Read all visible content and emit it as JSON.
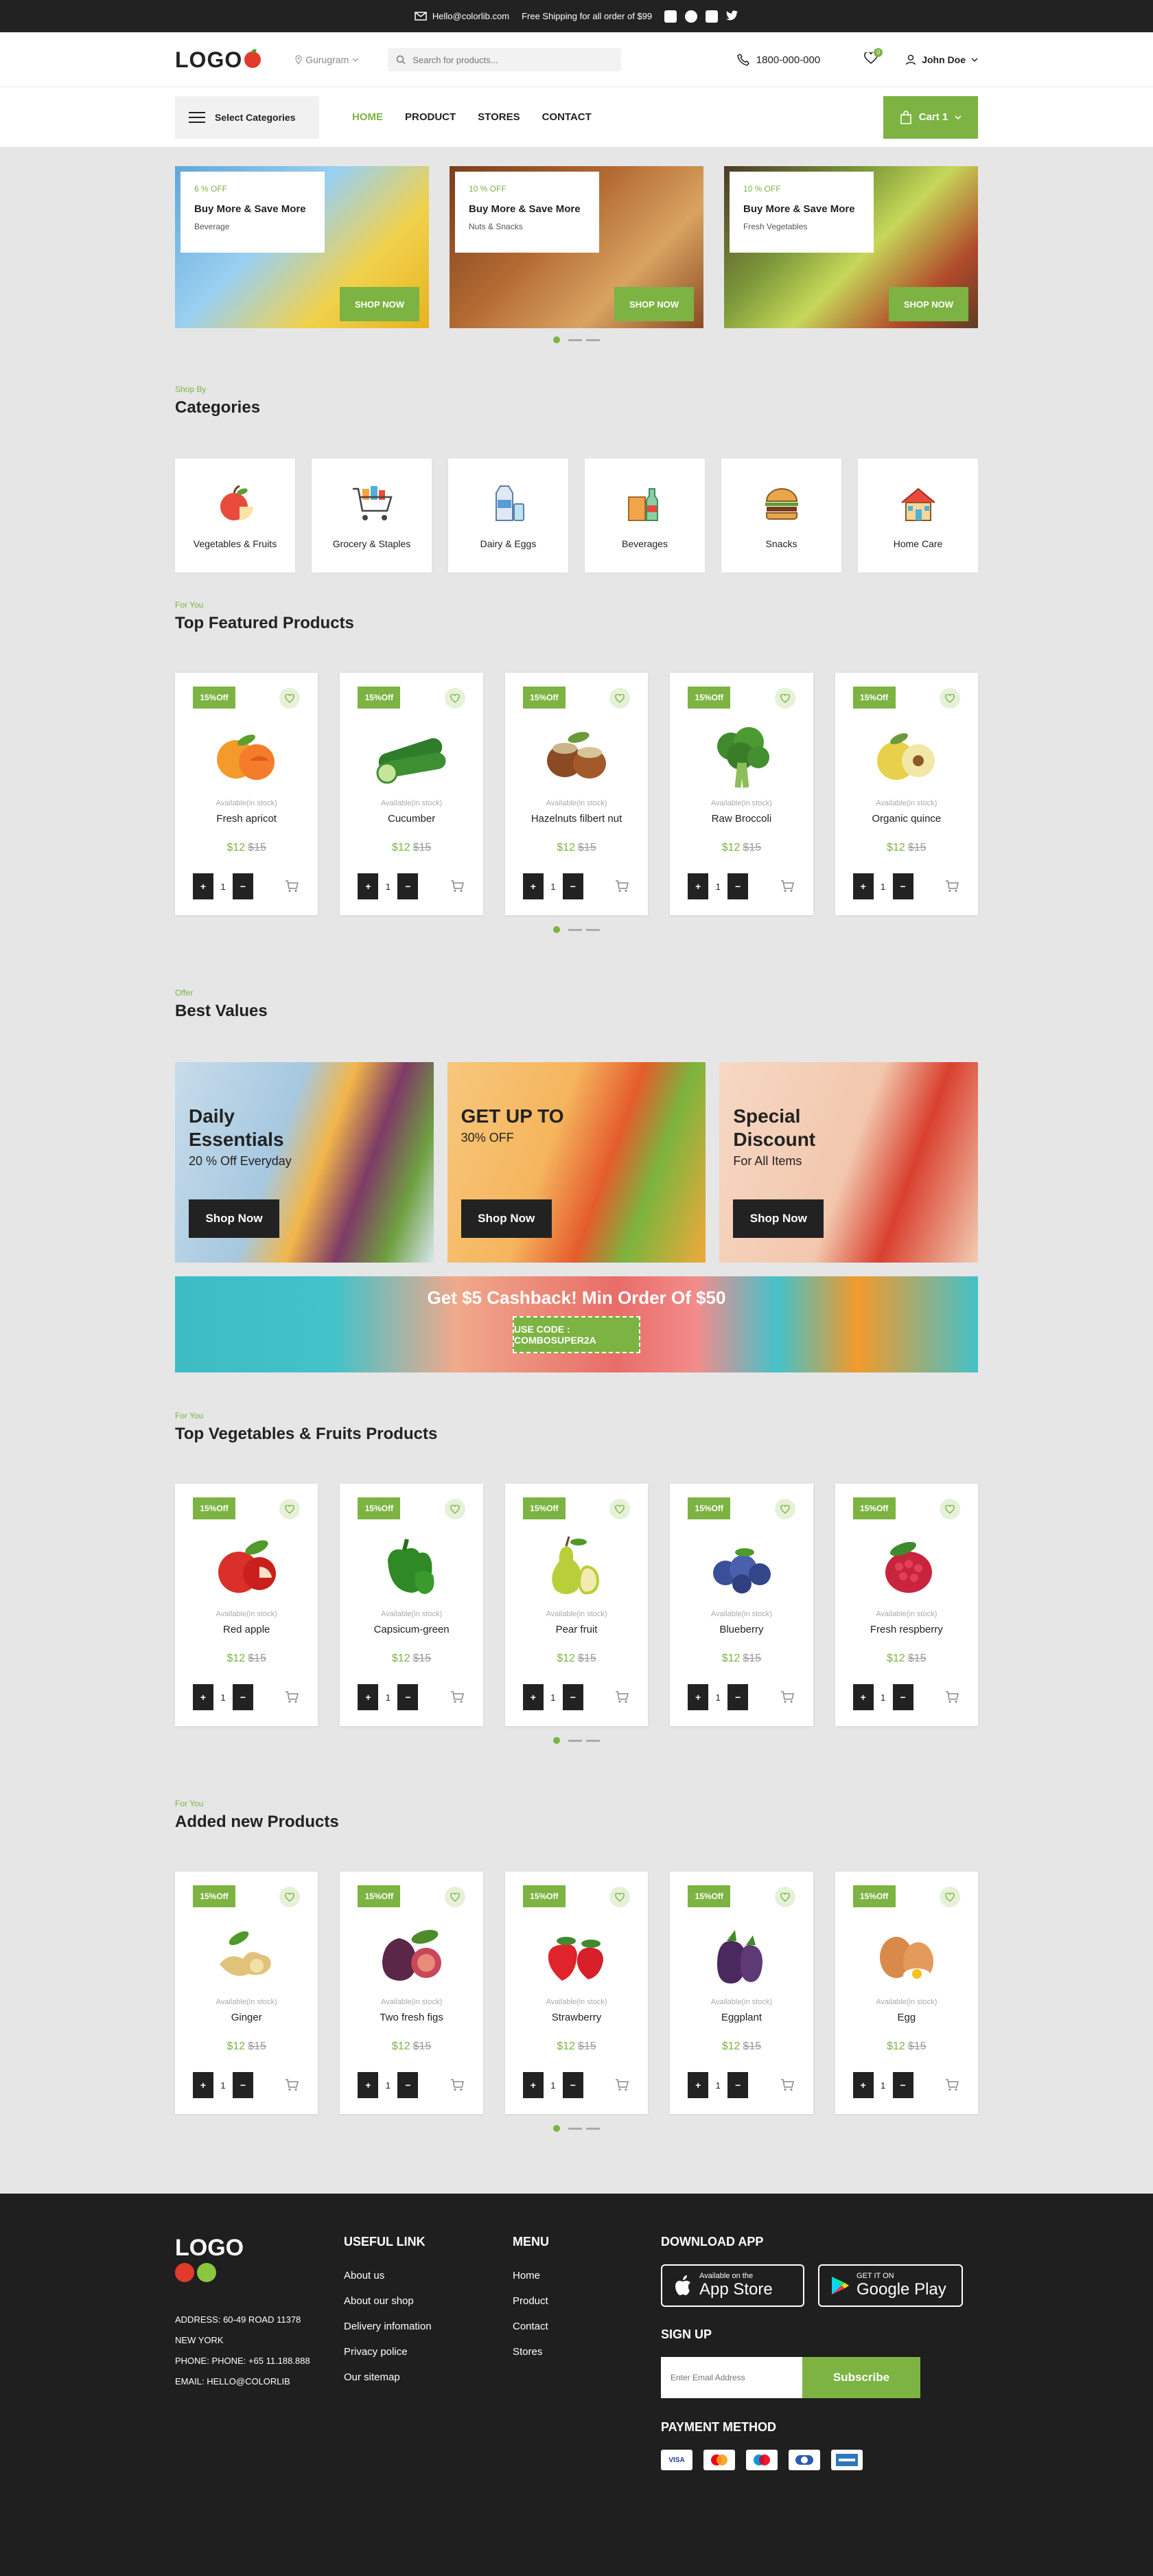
{
  "topbar": {
    "email": "Hello@colorlib.com",
    "shipping": "Free Shipping for all order of $99",
    "social": [
      "facebook-icon",
      "whatsapp-icon",
      "linkedin-icon",
      "twitter-icon"
    ]
  },
  "header": {
    "logo": "LOGO",
    "location": "Gurugram",
    "search_placeholder": "Search for products...",
    "phone": "1800-000-000",
    "wishlist_count": "0",
    "user": "John Doe"
  },
  "nav": {
    "categories_label": "Select Categories",
    "menu": [
      "HOME",
      "PRODUCT",
      "STORES",
      "CONTACT"
    ],
    "cart_label": "Cart 1"
  },
  "promos": [
    {
      "off": "6 % OFF",
      "title": "Buy More & Save More",
      "sub": "Beverage",
      "button": "SHOP NOW"
    },
    {
      "off": "10 % OFF",
      "title": "Buy More & Save More",
      "sub": "Nuts & Snacks",
      "button": "SHOP NOW"
    },
    {
      "off": "10 % OFF",
      "title": "Buy More & Save More",
      "sub": "Fresh Vegetables",
      "button": "SHOP NOW"
    }
  ],
  "categories_section": {
    "small": "Shop By",
    "title": "Categories",
    "items": [
      "Vegetables & Fruits",
      "Grocery & Staples",
      "Dairy & Eggs",
      "Beverages",
      "Snacks",
      "Home Care"
    ]
  },
  "product_common": {
    "sale": "15%Off",
    "availability": "Available(in stock)",
    "price": "$12",
    "old_price": "$15",
    "qty": "1",
    "plus": "+",
    "minus": "−"
  },
  "featured": {
    "small": "For You",
    "title": "Top Featured Products",
    "items": [
      "Fresh apricot",
      "Cucumber",
      "Hazelnuts filbert nut",
      "Raw Broccoli",
      "Organic quince"
    ]
  },
  "best_values": {
    "small": "Offer",
    "title": "Best Values",
    "cards": [
      {
        "title": "Daily Essentials",
        "sub": "20 % Off Everyday",
        "button": "Shop Now"
      },
      {
        "title": "GET UP TO",
        "sub": "30% OFF",
        "button": "Shop Now"
      },
      {
        "title": "Special Discount",
        "sub": "For All Items",
        "button": "Shop Now"
      }
    ],
    "cashback": "Get $5 Cashback! Min Order Of $50",
    "code": "USE CODE : COMBOSUPER2A"
  },
  "vegfruit": {
    "small": "For You",
    "title": "Top Vegetables & Fruits Products",
    "items": [
      "Red apple",
      "Capsicum-green",
      "Pear fruit",
      "Blueberry",
      "Fresh respberry"
    ]
  },
  "added": {
    "small": "For You",
    "title": "Added new Products",
    "items": [
      "Ginger",
      "Two fresh figs",
      "Strawberry",
      "Eggplant",
      "Egg"
    ]
  },
  "footer": {
    "logo": "LOGO",
    "address": [
      "ADDRESS: 60-49 ROAD 11378",
      "NEW YORK",
      "PHONE: PHONE: +65 11.188.888",
      "EMAIL: HELLO@COLORLIB"
    ],
    "useful_title": "USEFUL LINK",
    "useful_links": [
      "About us",
      "About our shop",
      "Delivery infomation",
      "Privacy police",
      "Our sitemap"
    ],
    "menu_title": "MENU",
    "menu_links": [
      "Home",
      "Product",
      "Contact",
      "Stores"
    ],
    "download_title": "DOWNLOAD APP",
    "app_store_small": "Available on the",
    "app_store_big": "App Store",
    "play_small": "GET IT ON",
    "play_big": "Google Play",
    "signup_title": "SIGN UP",
    "email_placeholder": "Enter Email Address",
    "subscribe": "Subscribe",
    "payment_title": "PAYMENT METHOD",
    "payments": [
      "VISA",
      "MC",
      "MAESTRO",
      "DINERS",
      "AMEX"
    ]
  },
  "colors": {
    "accent": "#7cb342",
    "dark": "#222222",
    "footer": "#1f1f1f"
  }
}
